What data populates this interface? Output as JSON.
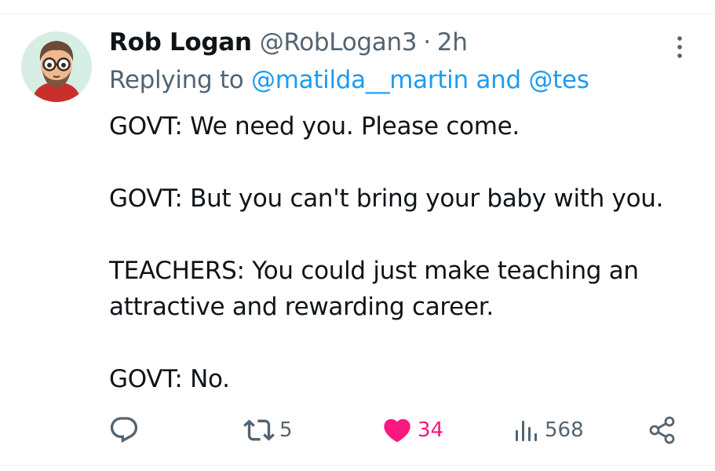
{
  "tweet": {
    "author_name": "Rob Logan",
    "handle": "@RobLogan3",
    "separator": "·",
    "time": "2h",
    "replying_prefix": "Replying to ",
    "reply_mentions": [
      "@matilda__martin",
      "@tes"
    ],
    "reply_conjunction": " and ",
    "body": [
      "GOVT: We need you. Please come.",
      "GOVT: But you can't bring your baby with you.",
      "TEACHERS: You could just make teaching an attractive and rewarding career.",
      "GOVT: No."
    ]
  },
  "actions": {
    "reply": {
      "icon": "reply-icon",
      "count": ""
    },
    "retweet": {
      "icon": "retweet-icon",
      "count": "5"
    },
    "like": {
      "icon": "heart-icon",
      "count": "34",
      "liked": true
    },
    "views": {
      "icon": "views-icon",
      "count": "568"
    },
    "share": {
      "icon": "share-icon"
    }
  },
  "colors": {
    "text": "#0f1419",
    "secondary": "#536471",
    "link": "#1d9bf0",
    "like": "#f91880",
    "divider": "#eff3f4"
  }
}
